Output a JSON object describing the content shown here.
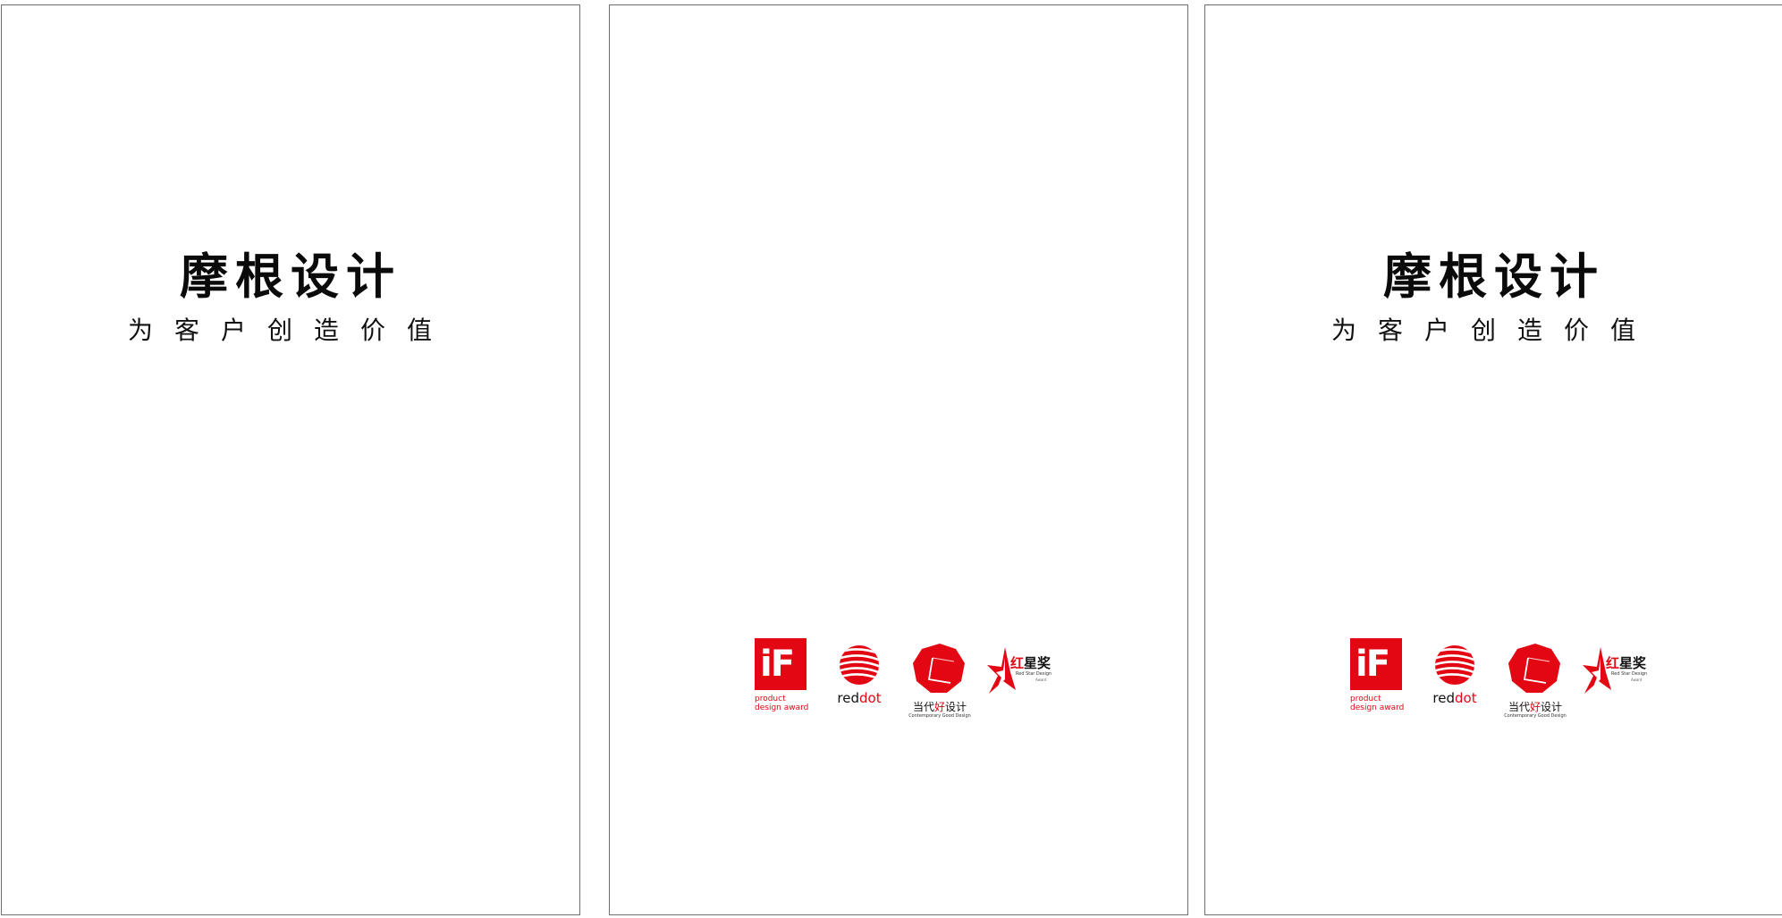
{
  "brand": {
    "title": "摩根设计",
    "slogan": [
      "为",
      "客",
      "户",
      "创",
      "造",
      "价",
      "值"
    ]
  },
  "awards": {
    "if": {
      "mark": "iF",
      "caption_line1": "product",
      "caption_line2": "design award"
    },
    "reddot": {
      "text_red": "red",
      "text_dot": "dot"
    },
    "cgd": {
      "caption_pre": "当代",
      "caption_hi": "好",
      "caption_post": "设计",
      "caption_en": "Contemporary Good Design"
    },
    "redstar": {
      "title_red": "红",
      "title_rest": "星奖",
      "subtitle": "Red Star Design",
      "subtitle2": "Award"
    }
  },
  "colors": {
    "brand_red": "#e30613",
    "text": "#0a0a0a",
    "page_border": "#6f6f6f"
  },
  "icons": [
    "if-logo-icon",
    "reddot-logo-icon",
    "good-design-logo-icon",
    "red-star-logo-icon"
  ]
}
